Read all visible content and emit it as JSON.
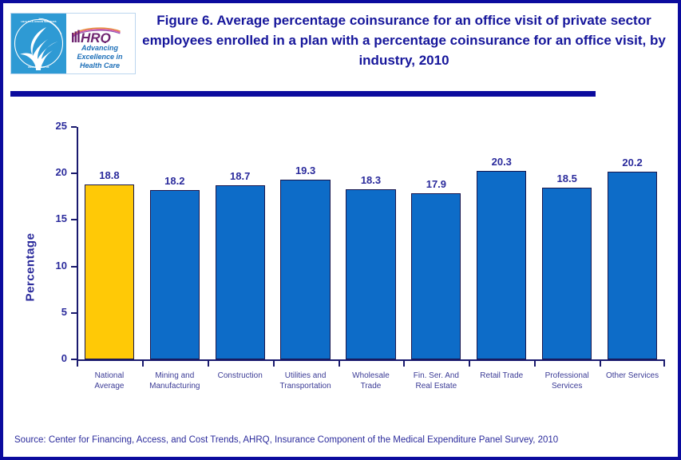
{
  "header": {
    "title": "Figure 6. Average percentage coinsurance for an office visit of private sector employees enrolled in a plan with a percentage coinsurance for an office visit, by industry, 2010",
    "logo": {
      "hhs_seal_name": "hhs-seal-icon",
      "ahrq_wordmark": "AHRQ",
      "ahrq_tagline": "Advancing\nExcellence in\nHealth Care"
    }
  },
  "footer": {
    "source": "Source: Center for Financing, Access, and Cost Trends, AHRQ, Insurance Component of the Medical Expenditure Panel Survey, 2010"
  },
  "colors": {
    "frame": "#0b0b9e",
    "title_text": "#16169b",
    "axis_text": "#2b2b9c",
    "bar_default": "#0d6cc8",
    "bar_highlight": "#ffc906",
    "bar_outline": "#17174f",
    "ahrq_purple": "#7b2a7b",
    "hhs_blue": "#2e9ad4"
  },
  "chart_data": {
    "type": "bar",
    "title": "Figure 6. Average percentage coinsurance for an office visit of private sector employees enrolled in a plan with a percentage coinsurance for an office visit, by industry, 2010",
    "xlabel": "",
    "ylabel": "Percentage",
    "ylim": [
      0,
      25
    ],
    "yticks": [
      0,
      5,
      10,
      15,
      20,
      25
    ],
    "ytick_labels": [
      "0",
      "5",
      "10",
      "15",
      "20",
      "25"
    ],
    "grid": false,
    "legend": "none",
    "categories": [
      "National Average",
      "Mining and Manufacturing",
      "Construction",
      "Utilities and Transportation",
      "Wholesale Trade",
      "Fin. Ser. And Real Estate",
      "Retail Trade",
      "Professional Services",
      "Other Services"
    ],
    "category_lines": [
      [
        "National",
        "Average"
      ],
      [
        "Mining and",
        "Manufacturing"
      ],
      [
        "Construction",
        ""
      ],
      [
        "Utilities and",
        "Transportation"
      ],
      [
        "Wholesale",
        "Trade"
      ],
      [
        "Fin. Ser. And",
        "Real Estate"
      ],
      [
        "Retail Trade",
        ""
      ],
      [
        "Professional",
        "Services"
      ],
      [
        "Other Services",
        ""
      ]
    ],
    "values": [
      18.8,
      18.2,
      18.7,
      19.3,
      18.3,
      17.9,
      20.3,
      18.5,
      20.2
    ],
    "value_labels": [
      "18.8",
      "18.2",
      "18.7",
      "19.3",
      "18.3",
      "17.9",
      "20.3",
      "18.5",
      "20.2"
    ],
    "highlight_index": 0
  }
}
